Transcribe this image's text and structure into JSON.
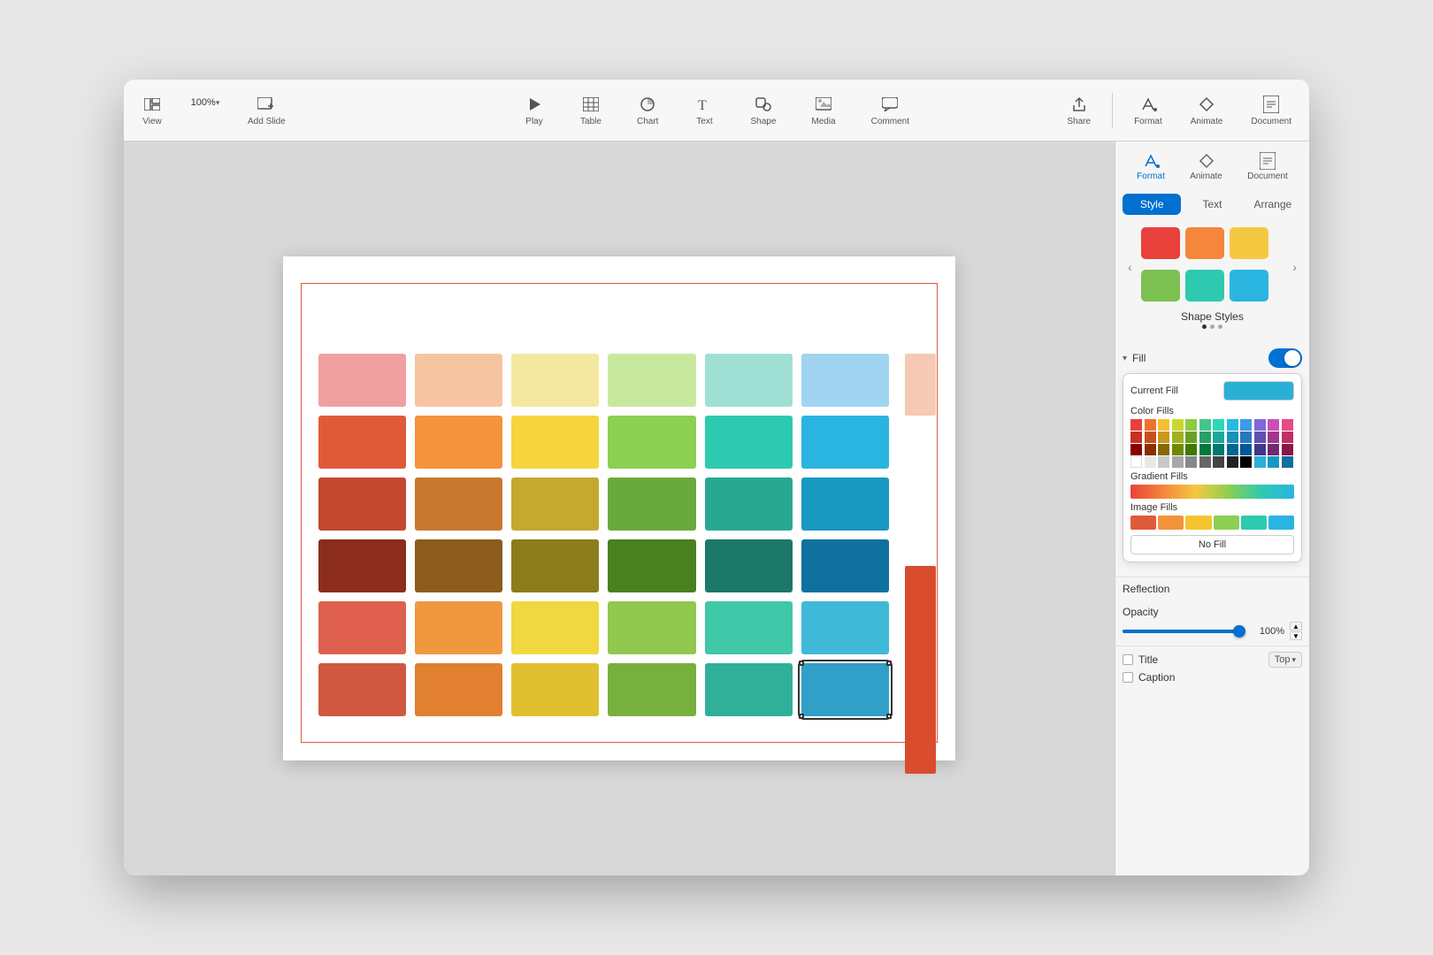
{
  "toolbar": {
    "view_label": "View",
    "zoom_value": "100%",
    "zoom_arrow": "▾",
    "add_slide_label": "Add Slide",
    "play_label": "Play",
    "table_label": "Table",
    "chart_label": "Chart",
    "text_label": "Text",
    "shape_label": "Shape",
    "media_label": "Media",
    "comment_label": "Comment",
    "share_label": "Share",
    "format_label": "Format",
    "animate_label": "Animate",
    "document_label": "Document"
  },
  "panel": {
    "style_tab": "Style",
    "text_tab": "Text",
    "arrange_tab": "Arrange",
    "shape_styles_label": "Shape Styles",
    "fill_label": "Fill",
    "current_fill_label": "Current Fill",
    "color_fills_label": "Color Fills",
    "gradient_fills_label": "Gradient Fills",
    "image_fills_label": "Image Fills",
    "no_fill_label": "No Fill",
    "reflection_label": "Reflection",
    "opacity_label": "Opacity",
    "opacity_value": "100%",
    "title_label": "Title",
    "title_position": "Top",
    "caption_label": "Caption"
  },
  "color_rows": [
    [
      "#f0a0a0",
      "#f5c4a0",
      "#f5e8a0",
      "#c8e8a0",
      "#a0e0d4",
      "#a0d4f0"
    ],
    [
      "#e05a3a",
      "#f5923c",
      "#f5d43c",
      "#8ccf52",
      "#2dcab0",
      "#2ab5e0"
    ],
    [
      "#c44830",
      "#c87830",
      "#c4a830",
      "#6aaa3c",
      "#28a890",
      "#1898c0"
    ],
    [
      "#8c2c1c",
      "#8c5c1c",
      "#8c7c1c",
      "#4a8020",
      "#1c7868",
      "#1070a0"
    ],
    [
      "#e06050",
      "#f09840",
      "#f0d840",
      "#90c850",
      "#40c8a8",
      "#40b8d8"
    ],
    [
      "#d05840",
      "#e08030",
      "#e0c030",
      "#78b040",
      "#30b098",
      "#30a0c8"
    ]
  ],
  "shape_swatches_row1": [
    {
      "color": "#e8413c"
    },
    {
      "color": "#f5863c"
    },
    {
      "color": "#f5c842"
    }
  ],
  "shape_swatches_row2": [
    {
      "color": "#7dc052"
    },
    {
      "color": "#2dcab0"
    },
    {
      "color": "#2ab5e0"
    }
  ]
}
